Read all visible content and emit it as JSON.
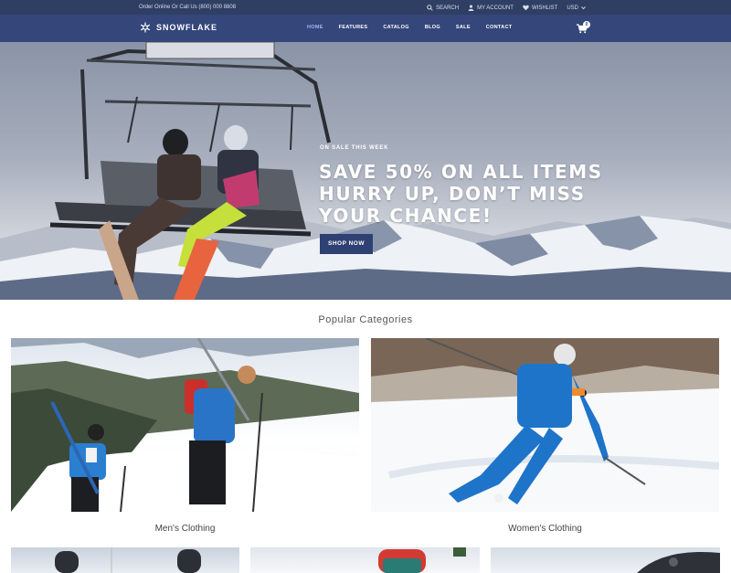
{
  "topbar": {
    "phone_text": "Order Online Or Call Us (800) 000 8808",
    "search_label": "SEARCH",
    "account_label": "MY ACCOUNT",
    "wishlist_label": "WISHLIST",
    "currency_label": "USD"
  },
  "nav": {
    "logo_text": "SNOWFLAKE",
    "links": [
      "HOME",
      "FEATURES",
      "CATALOG",
      "BLOG",
      "SALE",
      "CONTACT"
    ],
    "active_link": "HOME",
    "cart_count": "0"
  },
  "hero": {
    "eyebrow": "ON SALE THIS WEEK",
    "headline_lines": [
      "SAVE 50% ON ALL ITEMS",
      "HURRY UP, DON’T MISS",
      "YOUR CHANCE!"
    ],
    "button_label": "SHOP NOW"
  },
  "categories": {
    "title": "Popular Categories",
    "items": [
      {
        "label": "Men's Clothing"
      },
      {
        "label": "Women's Clothing"
      }
    ]
  },
  "colors": {
    "topbar_bg": "#2f3f63",
    "nav_bg": "#34467a",
    "button_bg": "#2f4172",
    "active_link": "#9fb8ff"
  }
}
